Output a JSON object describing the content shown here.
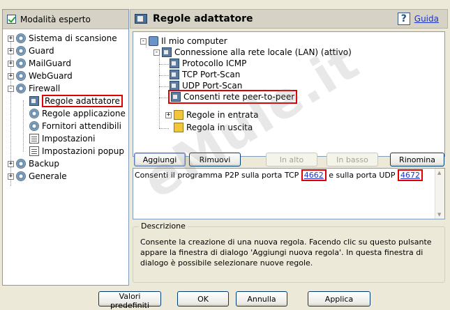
{
  "left_panel": {
    "expert_mode_label": "Modalità esperto",
    "tree": [
      {
        "label": "Sistema di scansione",
        "expander": "+"
      },
      {
        "label": "Guard",
        "expander": "+"
      },
      {
        "label": "MailGuard",
        "expander": "+"
      },
      {
        "label": "WebGuard",
        "expander": "+"
      },
      {
        "label": "Firewall",
        "expander": "-"
      },
      {
        "label": "Regole adattatore",
        "selected": true
      },
      {
        "label": "Regole applicazione"
      },
      {
        "label": "Fornitori attendibili"
      },
      {
        "label": "Impostazioni"
      },
      {
        "label": "Impostazioni popup"
      },
      {
        "label": "Backup",
        "expander": "+"
      },
      {
        "label": "Generale",
        "expander": "+"
      }
    ]
  },
  "header": {
    "title": "Regole adattatore",
    "help_label": "Guida"
  },
  "rules_tree": {
    "root": "Il mio computer",
    "connection": "Connessione alla rete locale (LAN) (attivo)",
    "rules": [
      "Protocollo ICMP",
      "TCP Port-Scan",
      "UDP Port-Scan",
      "Consenti rete peer-to-peer"
    ],
    "incoming": "Regole in entrata",
    "outgoing": "Regola in uscita"
  },
  "buttons": {
    "add": "Aggiungi",
    "remove": "Rimuovi",
    "up": "In alto",
    "down": "In basso",
    "rename": "Rinomina"
  },
  "rule_description": {
    "text_before": "Consenti il programma P2P sulla porta TCP",
    "tcp_port": "4662",
    "text_middle": "e sulla porta UDP",
    "udp_port": "4672"
  },
  "description": {
    "legend": "Descrizione",
    "text": "Consente la creazione di una nuova regola. Facendo clic su questo pulsante appare la finestra di dialogo 'Aggiungi nuova regola'. In questa finestra di dialogo è possibile selezionare nuove regole."
  },
  "footer": {
    "defaults": "Valori predefiniti",
    "ok": "OK",
    "cancel": "Annulla",
    "apply": "Applica"
  },
  "watermark": "eMule.it"
}
